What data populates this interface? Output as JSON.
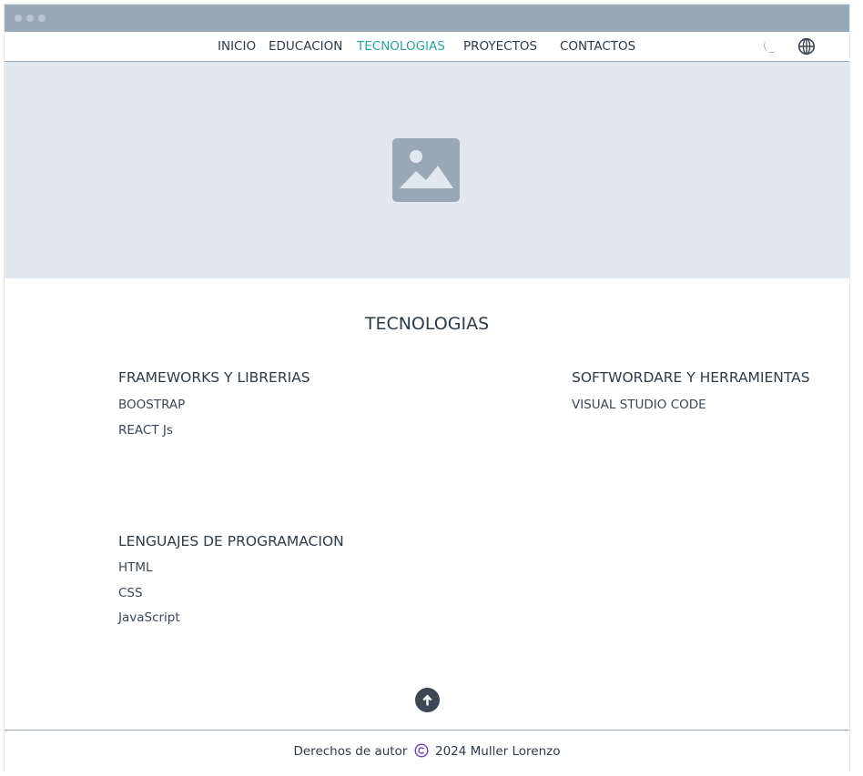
{
  "nav": {
    "items": [
      "INICIO",
      "EDUCACION",
      "TECNOLOGIAS",
      "PROYECTOS",
      "CONTACTOS"
    ],
    "active": "TECNOLOGIAS",
    "icons": [
      "moon-icon",
      "globe-icon"
    ],
    "active_color": "#26a69a"
  },
  "hero": {
    "icon": "image-placeholder-icon",
    "background": "#e2e8f0"
  },
  "main": {
    "title": "TECNOLOGIAS",
    "groups": [
      {
        "title": "FRAMEWORKS Y LIBRERIAS",
        "items": [
          "BOOSTRAP",
          "REACT Js"
        ]
      },
      {
        "title": "SOFTWORDARE Y HERRAMIENTAS",
        "items": [
          "VISUAL STUDIO CODE"
        ]
      },
      {
        "title": "LENGUAJES DE PROGRAMACION",
        "items": [
          "HTML",
          "CSS",
          "JavaScript"
        ]
      }
    ]
  },
  "scroll_top": {
    "icon": "arrow-up-icon"
  },
  "footer": {
    "prefix": "Derechos de autor",
    "copyright_icon": "copyright-icon",
    "suffix": "2024 Muller Lorenzo",
    "icon_color": "#6b3fc7"
  }
}
